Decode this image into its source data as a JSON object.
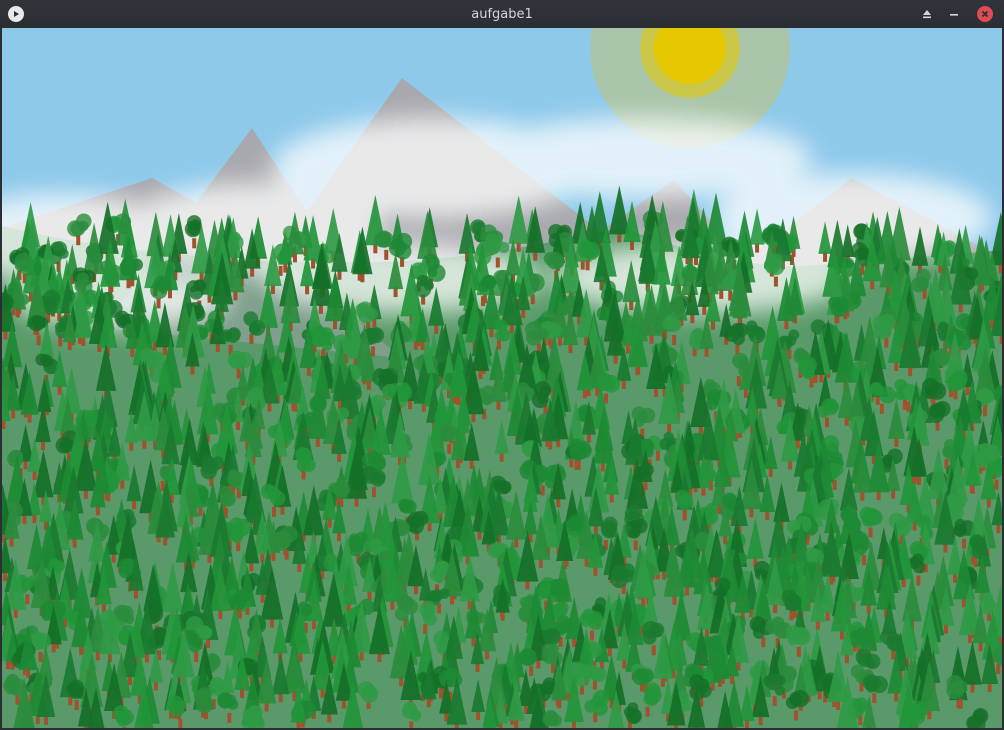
{
  "window": {
    "title": "aufgabe1",
    "controls": {
      "eject": "eject-icon",
      "minimize": "minimize-icon",
      "close": "close-icon"
    },
    "app_icon": "play-icon"
  },
  "colors": {
    "sky": "#8ec9ea",
    "hill": "#5a9a6a",
    "mountain": "#a8a9ae",
    "sun_core": "#e6c800",
    "sun_halo": "#c9c25b",
    "conifer": "#1d8a34",
    "trunk": "#a0522d",
    "close_button": "#e04a54"
  }
}
